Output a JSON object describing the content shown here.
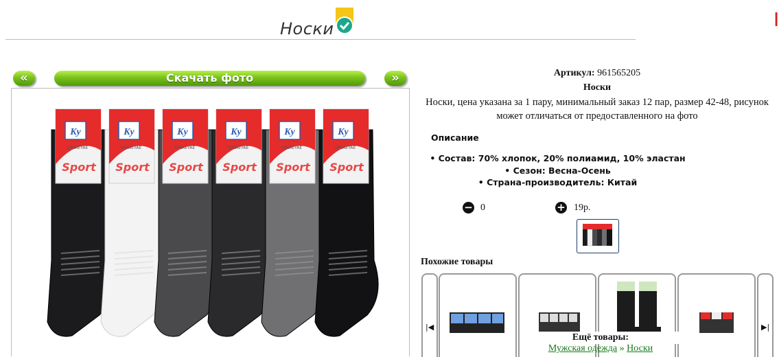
{
  "page": {
    "title": "Носки"
  },
  "gallery": {
    "prev_label": "«",
    "next_label": "»",
    "download_label": "Скачать фото",
    "label_brand": "Ky",
    "label_sub": "SPKAEYAE",
    "label_sport": "Sport",
    "sock_colors": [
      "#1b1b1d",
      "#f3f3f3",
      "#4a4a4c",
      "#2a2a2c",
      "#707072",
      "#121214"
    ]
  },
  "product": {
    "sku_label": "Артикул:",
    "sku_value": "961565205",
    "name": "Носки",
    "description": "Носки, цена указана за 1 пару, минимальный заказ 12 пар, размер 42-48, рисунок может отличаться от предоставленного на фото",
    "description_heading": "Описание",
    "attributes": [
      "Состав: 70% хлопок, 20% полиамид, 10% эластан",
      "Сезон: Весна-Осень",
      "Страна-производитель: Китай"
    ],
    "quantity": "0",
    "price": "19р."
  },
  "similar": {
    "title": "Похожие товары",
    "prev_icon": "skip-back-icon",
    "next_icon": "skip-forward-icon"
  },
  "more": {
    "title": "Ещё товары:",
    "link_category": "Мужская одежда",
    "separator": "»",
    "link_sub": "Носки"
  },
  "colors": {
    "button_green": "#5fae10",
    "badge_yellow": "#f5c518",
    "badge_check": "#1aa88a",
    "link_green": "#1a7a1a",
    "label_red": "#e62b2b"
  }
}
